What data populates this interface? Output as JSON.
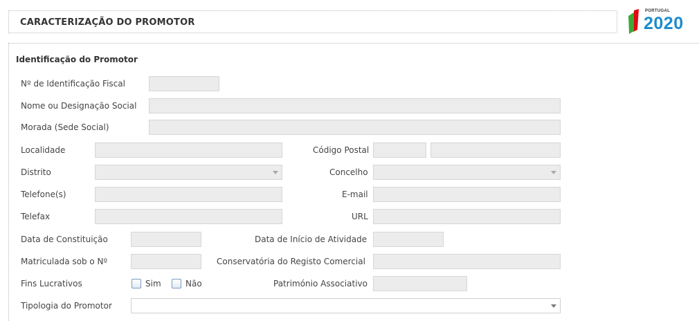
{
  "header": {
    "title": "CARACTERIZAÇÃO DO PROMOTOR",
    "logo": {
      "country": "PORTUGAL",
      "year": "2020",
      "colors": [
        "#1c8ccd",
        "#e30613",
        "#3aaa35"
      ]
    }
  },
  "section": {
    "title": "Identificação do Promotor"
  },
  "fields": {
    "nif": {
      "label": "Nº de Identificação Fiscal",
      "value": ""
    },
    "nome": {
      "label": "Nome ou Designação Social",
      "value": ""
    },
    "morada": {
      "label": "Morada (Sede Social)",
      "value": ""
    },
    "localidade": {
      "label": "Localidade",
      "value": ""
    },
    "codigo_postal": {
      "label": "Código Postal",
      "value": "",
      "value_ext": ""
    },
    "distrito": {
      "label": "Distrito",
      "value": ""
    },
    "concelho": {
      "label": "Concelho",
      "value": ""
    },
    "telefone": {
      "label": "Telefone(s)",
      "value": ""
    },
    "email": {
      "label": "E-mail",
      "value": ""
    },
    "telefax": {
      "label": "Telefax",
      "value": ""
    },
    "url": {
      "label": "URL",
      "value": ""
    },
    "data_constituicao": {
      "label": "Data de Constituição",
      "value": ""
    },
    "data_inicio": {
      "label": "Data de Início de Atividade",
      "value": ""
    },
    "matricula": {
      "label": "Matriculada sob o Nº",
      "value": ""
    },
    "conservatoria": {
      "label": "Conservatória do Registo Comercial",
      "value": ""
    },
    "fins_lucrativos": {
      "label": "Fins Lucrativos",
      "sim": "Sim",
      "nao": "Não"
    },
    "patrimonio": {
      "label": "Património Associativo",
      "value": ""
    },
    "tipologia": {
      "label": "Tipologia do Promotor",
      "value": ""
    }
  }
}
